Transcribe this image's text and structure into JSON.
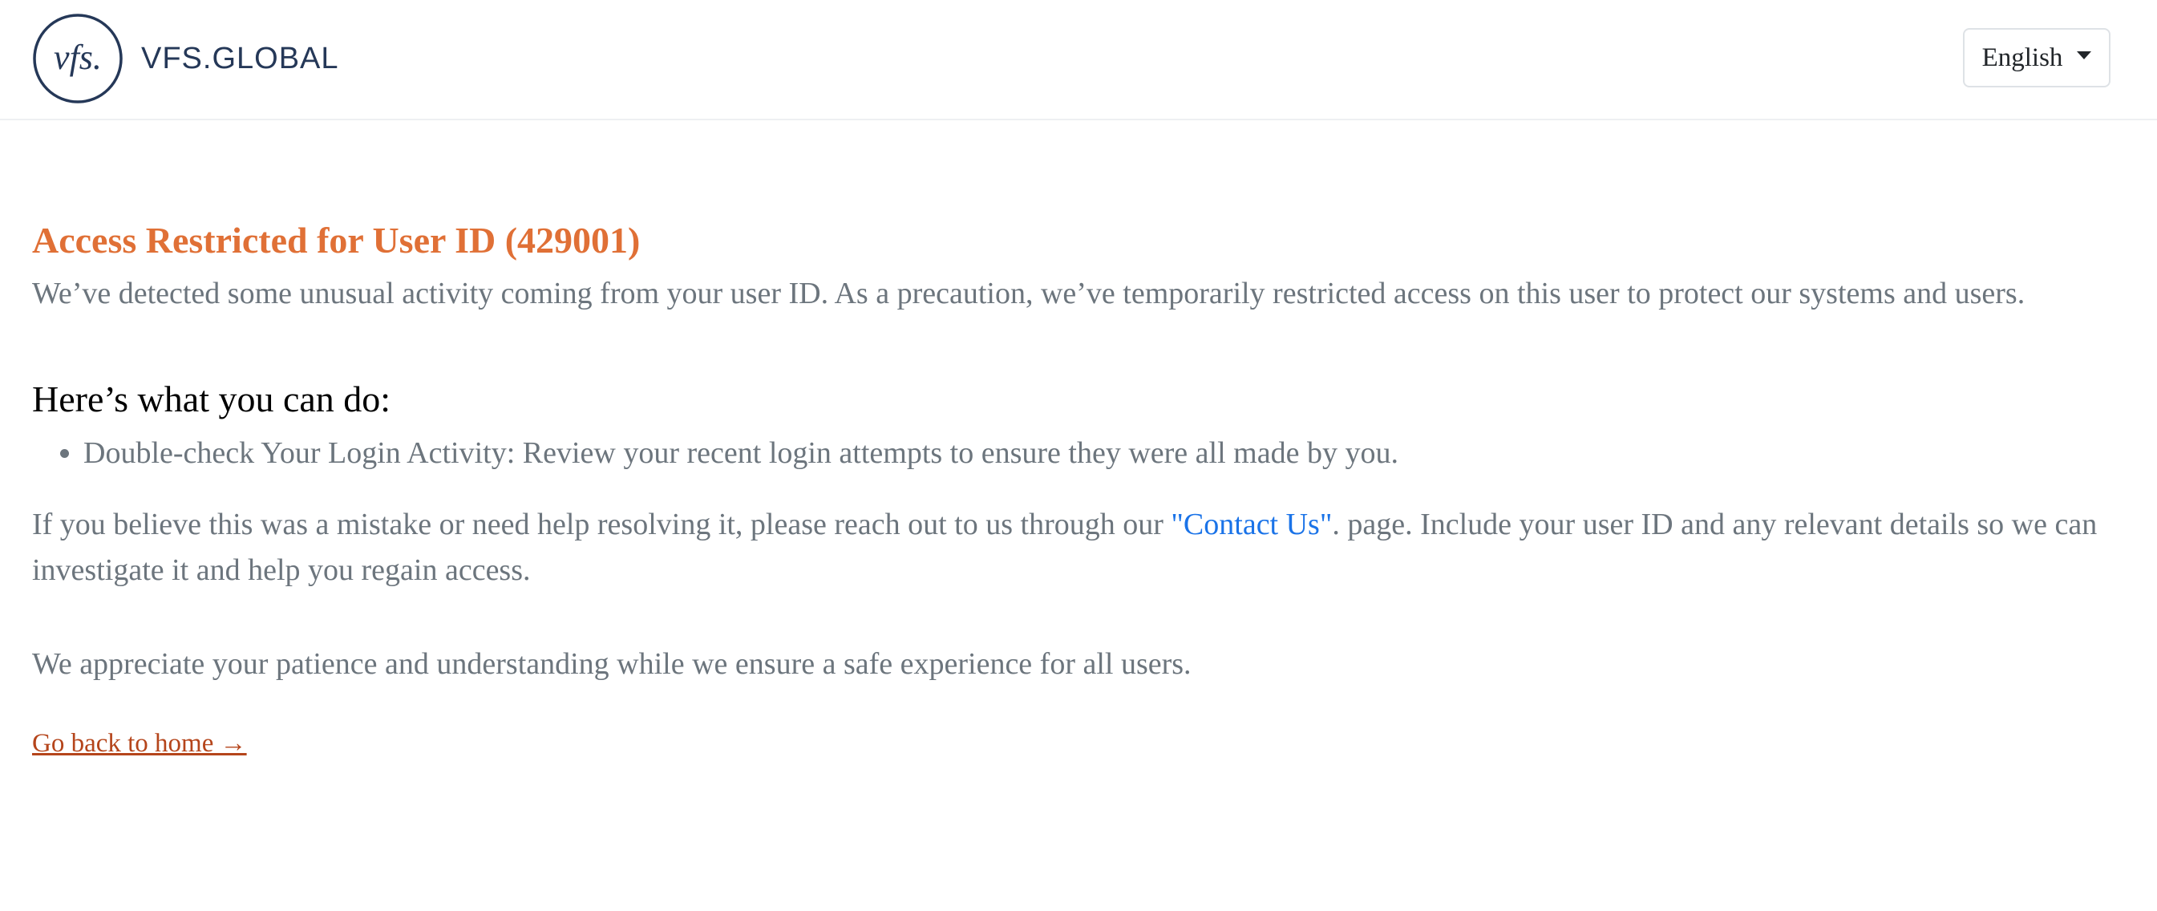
{
  "header": {
    "brand_text": "VFS.GLOBAL",
    "logo_mark_text": "vfs.",
    "language": {
      "selected": "English"
    }
  },
  "main": {
    "title": "Access Restricted for User ID (429001)",
    "intro": "We’ve detected some unusual activity coming from your user ID. As a precaution, we’ve temporarily restricted access on this user to protect our systems and users.",
    "subheading": "Here’s what you can do:",
    "actions": [
      "Double-check Your Login Activity: Review your recent login attempts to ensure they were all made by you."
    ],
    "help": {
      "before": "If you believe this was a mistake or need help resolving it, please reach out to us through our ",
      "link_text": "\"Contact Us\"",
      "after": ". page. Include your user ID and any relevant details so we can investigate it and help you regain access."
    },
    "thanks": "We appreciate your patience and understanding while we ensure a safe experience for all users.",
    "home_link": "Go back to home →"
  },
  "colors": {
    "title": "#e07036",
    "body_text": "#6c757d",
    "link": "#1a73e8",
    "home_link": "#b5451b",
    "brand": "#253858"
  }
}
